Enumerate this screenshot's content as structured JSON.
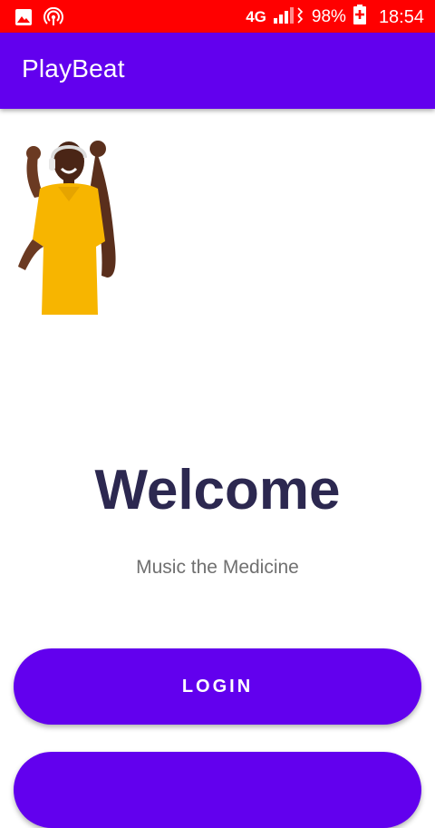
{
  "status_bar": {
    "background": "#ff0000",
    "left_icons": [
      "image-icon",
      "hotspot-icon"
    ],
    "network": "4G",
    "battery": "98%",
    "time": "18:54"
  },
  "app_bar": {
    "title": "PlayBeat",
    "background": "#6200ee"
  },
  "hero_image": {
    "description_icon": "person-celebrating-with-headphones-image"
  },
  "main": {
    "welcome": "Welcome",
    "tagline": "Music the Medicine"
  },
  "buttons": {
    "login_label": "LOGIN",
    "second_label": "",
    "color": "#6200ee"
  }
}
